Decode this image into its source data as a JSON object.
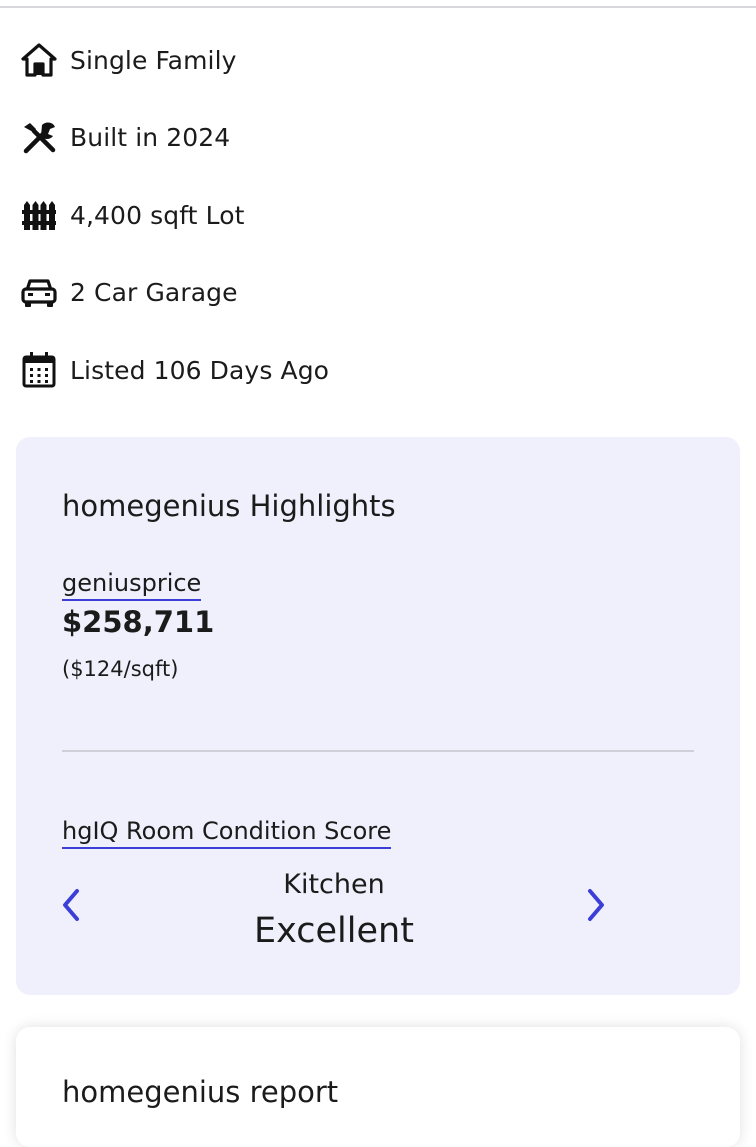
{
  "facts": [
    {
      "icon": "home-icon",
      "label": "Single Family"
    },
    {
      "icon": "tools-icon",
      "label": "Built in 2024"
    },
    {
      "icon": "fence-icon",
      "label": "4,400 sqft Lot"
    },
    {
      "icon": "car-icon",
      "label": "2 Car Garage"
    },
    {
      "icon": "calendar-icon",
      "label": "Listed 106 Days Ago"
    }
  ],
  "highlights": {
    "title": "homegenius Highlights",
    "geniusprice_label": "geniusprice",
    "price": "$258,711",
    "price_per_sqft": "($124/sqft)",
    "condition_label": "hgIQ Room Condition Score",
    "room": "Kitchen",
    "score": "Excellent"
  },
  "next_card": {
    "title": "homegenius report"
  },
  "colors": {
    "accent": "#3b3fd8",
    "card_bg": "#f0f0fc",
    "text": "#1b1b1b",
    "divider": "#cfcfd8"
  }
}
